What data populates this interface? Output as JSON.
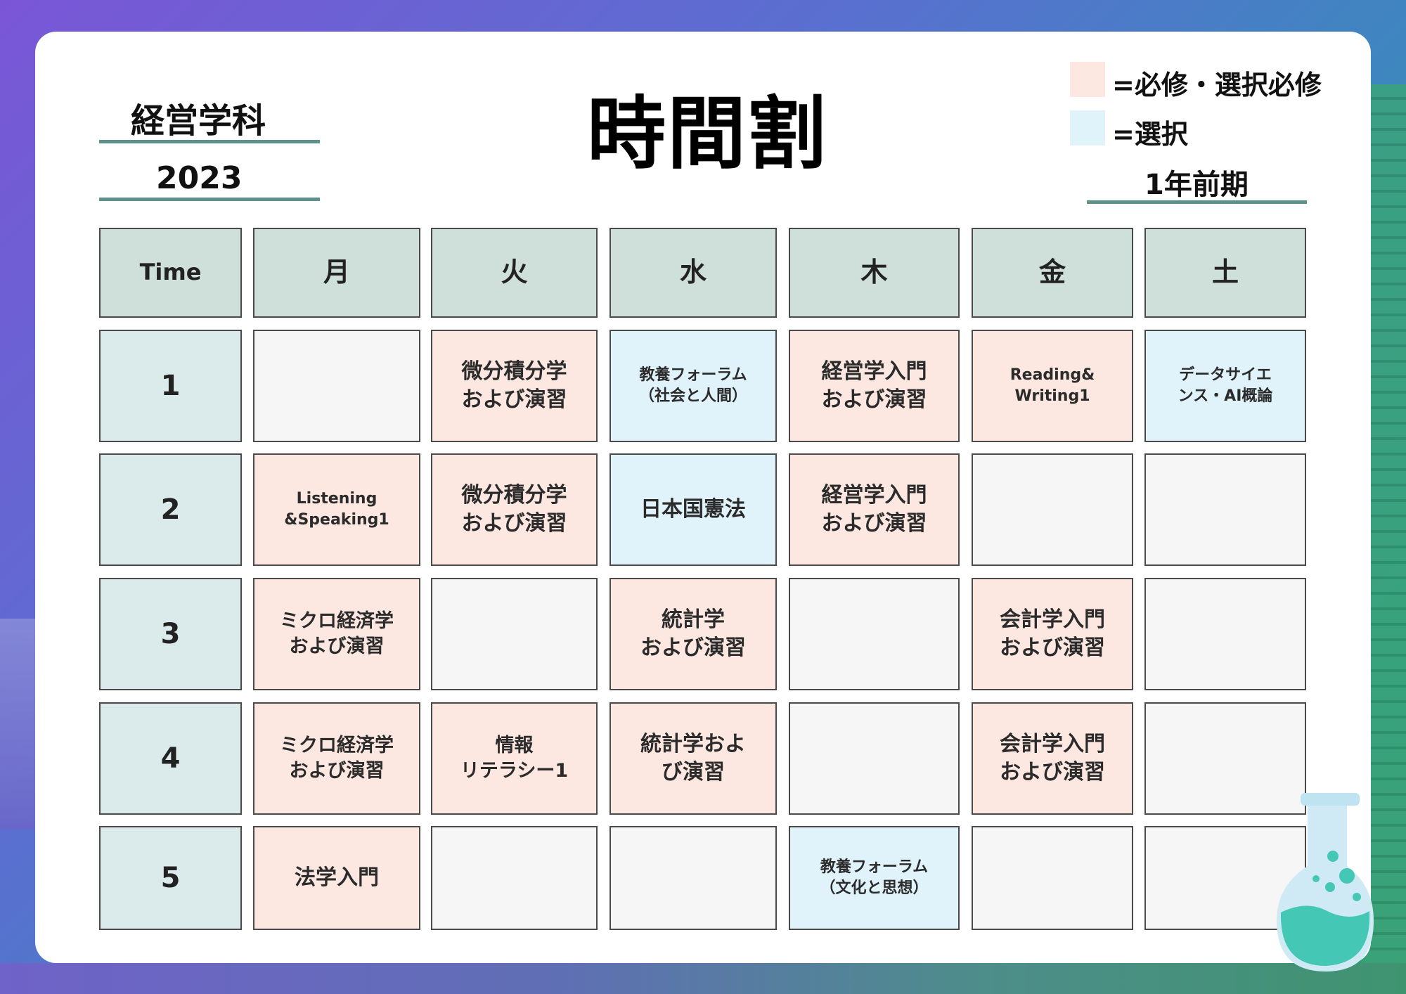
{
  "header": {
    "department": "経営学科",
    "year": "2023",
    "title": "時間割",
    "term": "1年前期"
  },
  "legend": {
    "required_label": "=必修・選択必修",
    "elective_label": "=選択",
    "required_color": "#fde8e1",
    "elective_color": "#e0f3fb"
  },
  "timetable": {
    "time_header": "Time",
    "days": [
      "月",
      "火",
      "水",
      "木",
      "金",
      "土"
    ],
    "periods": [
      "1",
      "2",
      "3",
      "4",
      "5"
    ],
    "rows": [
      [
        {
          "text": "",
          "type": "empty"
        },
        {
          "text": "微分積分学\nおよび演習",
          "type": "required"
        },
        {
          "text": "教養フォーラム\n（社会と人間）",
          "type": "elective"
        },
        {
          "text": "経営学入門\nおよび演習",
          "type": "required"
        },
        {
          "text": "Reading&\nWriting1",
          "type": "required"
        },
        {
          "text": "データサイエ\nンス・AI概論",
          "type": "elective"
        }
      ],
      [
        {
          "text": "Listening\n&Speaking1",
          "type": "required"
        },
        {
          "text": "微分積分学\nおよび演習",
          "type": "required"
        },
        {
          "text": "日本国憲法",
          "type": "elective"
        },
        {
          "text": "経営学入門\nおよび演習",
          "type": "required"
        },
        {
          "text": "",
          "type": "empty"
        },
        {
          "text": "",
          "type": "empty"
        }
      ],
      [
        {
          "text": "ミクロ経済学\nおよび演習",
          "type": "required"
        },
        {
          "text": "",
          "type": "empty"
        },
        {
          "text": "統計学\nおよび演習",
          "type": "required"
        },
        {
          "text": "",
          "type": "empty"
        },
        {
          "text": "会計学入門\nおよび演習",
          "type": "required"
        },
        {
          "text": "",
          "type": "empty"
        }
      ],
      [
        {
          "text": "ミクロ経済学\nおよび演習",
          "type": "required"
        },
        {
          "text": "情報\nリテラシー1",
          "type": "required"
        },
        {
          "text": "統計学およ\nび演習",
          "type": "required"
        },
        {
          "text": "",
          "type": "empty"
        },
        {
          "text": "会計学入門\nおよび演習",
          "type": "required"
        },
        {
          "text": "",
          "type": "empty"
        }
      ],
      [
        {
          "text": "法学入門",
          "type": "required"
        },
        {
          "text": "",
          "type": "empty"
        },
        {
          "text": "",
          "type": "empty"
        },
        {
          "text": "教養フォーラム\n（文化と思想）",
          "type": "elective"
        },
        {
          "text": "",
          "type": "empty"
        },
        {
          "text": "",
          "type": "empty"
        }
      ]
    ]
  },
  "decorations": {
    "flask": "flask-icon"
  }
}
